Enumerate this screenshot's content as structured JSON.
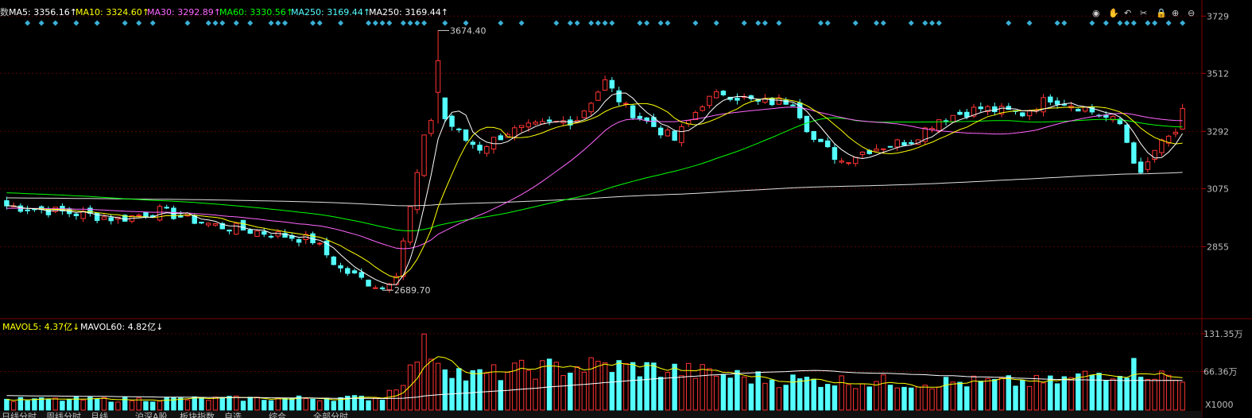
{
  "colors": {
    "up": "#ff3333",
    "down": "#54ffff",
    "grid": "#5a0000",
    "diamond": "#3ab0d8",
    "ma5": "#ffffff",
    "ma10": "#ffff00",
    "ma30": "#ff66ff",
    "ma60": "#00ff00",
    "ma250": "#e0e0e0",
    "text": "#cfcfcf"
  },
  "header": {
    "prefix": "数",
    "ma5_label": "MA5: 3356.16↑",
    "ma10_label": "MA10: 3324.60↑",
    "ma30_label": "MA30: 3292.89↑",
    "ma60_label": "MA60: 3330.56↑",
    "ma250a_label": "MA250: 3169.44↑",
    "ma250b_label": "MA250: 3169.44↑"
  },
  "toolbar": {
    "icons": [
      "eye-icon",
      "hand-icon",
      "undo-icon",
      "scissors-icon",
      "lock-icon",
      "zoom-in-icon",
      "zoom-out-icon"
    ],
    "glyphs": [
      "◉",
      "✋",
      "↶",
      "✂",
      "🔒",
      "⊕",
      "⊖"
    ]
  },
  "price_axis": {
    "ticks": [
      "3729",
      "3512",
      "3292",
      "3075",
      "2855"
    ],
    "values": [
      3729,
      3512,
      3292,
      3075,
      2855
    ]
  },
  "volume_header": {
    "mavol5_label": "MAVOL5: 4.37亿↓",
    "mavol60_label": "MAVOL60: 4.82亿↓"
  },
  "volume_axis": {
    "ticks": [
      "131.35万",
      "66.36万"
    ],
    "values": [
      131.35,
      66.36
    ],
    "unit_label": "X1000"
  },
  "chart_data": {
    "type": "candlestick",
    "ylim": [
      2600,
      3760
    ],
    "annotations": [
      {
        "label": "3674.40",
        "value": 3674.4
      },
      {
        "label": "2689.70",
        "value": 2689.7
      }
    ],
    "series_names": [
      "MA5",
      "MA10",
      "MA30",
      "MA60",
      "MA250",
      "MAVOL5",
      "MAVOL60"
    ],
    "candle_count": 170,
    "candles_note": "Daily index candles: downtrend from ~3020 to low 2689.70, spike to high 3674.40, then range ~3200–3500, recent close ~3360",
    "volume_ylim": [
      0,
      131.35
    ],
    "anchors": [
      {
        "i": 0,
        "c": 3010
      },
      {
        "i": 12,
        "c": 2975
      },
      {
        "i": 16,
        "c": 2960
      },
      {
        "i": 22,
        "c": 2990
      },
      {
        "i": 30,
        "c": 2935
      },
      {
        "i": 38,
        "c": 2905
      },
      {
        "i": 44,
        "c": 2880
      },
      {
        "i": 48,
        "c": 2770
      },
      {
        "i": 52,
        "c": 2720
      },
      {
        "i": 54,
        "c": 2700
      },
      {
        "i": 56,
        "c": 2760
      },
      {
        "i": 58,
        "c": 3000
      },
      {
        "i": 60,
        "c": 3260
      },
      {
        "i": 62,
        "c": 3420
      },
      {
        "i": 63,
        "c": 3340
      },
      {
        "i": 66,
        "c": 3260
      },
      {
        "i": 68,
        "c": 3230
      },
      {
        "i": 72,
        "c": 3290
      },
      {
        "i": 78,
        "c": 3320
      },
      {
        "i": 82,
        "c": 3340
      },
      {
        "i": 86,
        "c": 3480
      },
      {
        "i": 89,
        "c": 3380
      },
      {
        "i": 92,
        "c": 3330
      },
      {
        "i": 96,
        "c": 3260
      },
      {
        "i": 100,
        "c": 3400
      },
      {
        "i": 103,
        "c": 3440
      },
      {
        "i": 108,
        "c": 3400
      },
      {
        "i": 113,
        "c": 3410
      },
      {
        "i": 116,
        "c": 3260
      },
      {
        "i": 120,
        "c": 3180
      },
      {
        "i": 124,
        "c": 3225
      },
      {
        "i": 130,
        "c": 3260
      },
      {
        "i": 134,
        "c": 3340
      },
      {
        "i": 140,
        "c": 3380
      },
      {
        "i": 146,
        "c": 3360
      },
      {
        "i": 150,
        "c": 3420
      },
      {
        "i": 155,
        "c": 3380
      },
      {
        "i": 160,
        "c": 3320
      },
      {
        "i": 163,
        "c": 3120
      },
      {
        "i": 165,
        "c": 3220
      },
      {
        "i": 168,
        "c": 3290
      },
      {
        "i": 169,
        "c": 3360
      }
    ],
    "volume_anchors": [
      {
        "i": 0,
        "v": 18
      },
      {
        "i": 54,
        "v": 22
      },
      {
        "i": 58,
        "v": 70
      },
      {
        "i": 60,
        "v": 131
      },
      {
        "i": 62,
        "v": 95
      },
      {
        "i": 66,
        "v": 60
      },
      {
        "i": 76,
        "v": 75
      },
      {
        "i": 86,
        "v": 80
      },
      {
        "i": 96,
        "v": 72
      },
      {
        "i": 110,
        "v": 55
      },
      {
        "i": 130,
        "v": 50
      },
      {
        "i": 150,
        "v": 50
      },
      {
        "i": 162,
        "v": 78
      },
      {
        "i": 169,
        "v": 50
      }
    ]
  },
  "bottom_tabs": [
    "日线分时",
    "周线分时",
    "月线",
    "沪深A股",
    "板块指数",
    "自选",
    "综合",
    "全部分时"
  ]
}
